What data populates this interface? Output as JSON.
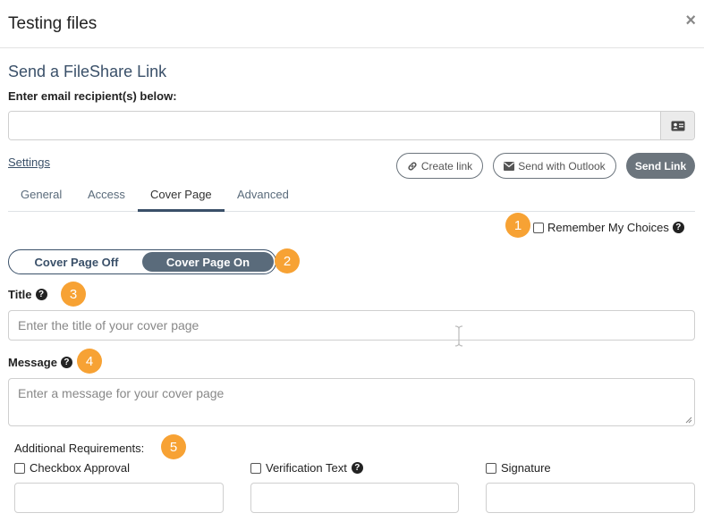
{
  "window": {
    "title": "Testing files",
    "close_label": "×"
  },
  "section_title": "Send a FileShare Link",
  "recipient": {
    "label": "Enter email recipient(s) below:",
    "value": "",
    "placeholder": "",
    "contact_icon": "address-card-icon"
  },
  "settings_link": "Settings",
  "actions": {
    "create_link": "Create link",
    "send_outlook": "Send with Outlook",
    "send_link": "Send Link"
  },
  "tabs": [
    {
      "label": "General"
    },
    {
      "label": "Access"
    },
    {
      "label": "Cover Page",
      "active": true
    },
    {
      "label": "Advanced"
    }
  ],
  "remember": {
    "label": "Remember My Choices",
    "checked": false
  },
  "cover_toggle": {
    "off_label": "Cover Page Off",
    "on_label": "Cover Page On",
    "selected": "on"
  },
  "title_field": {
    "label": "Title",
    "placeholder": "Enter the title of your cover page"
  },
  "message_field": {
    "label": "Message",
    "placeholder": "Enter a message for your cover page"
  },
  "requirements": {
    "label": "Additional Requirements:",
    "items": [
      {
        "label": "Checkbox Approval",
        "checked": false,
        "help": false
      },
      {
        "label": "Verification Text",
        "checked": false,
        "help": true
      },
      {
        "label": "Signature",
        "checked": false,
        "help": false
      }
    ]
  },
  "badges": [
    "1",
    "2",
    "3",
    "4",
    "5"
  ],
  "help_glyph": "?",
  "colors": {
    "accent": "#3a5069",
    "badge": "#f7a234",
    "send_button": "#6c757d"
  }
}
